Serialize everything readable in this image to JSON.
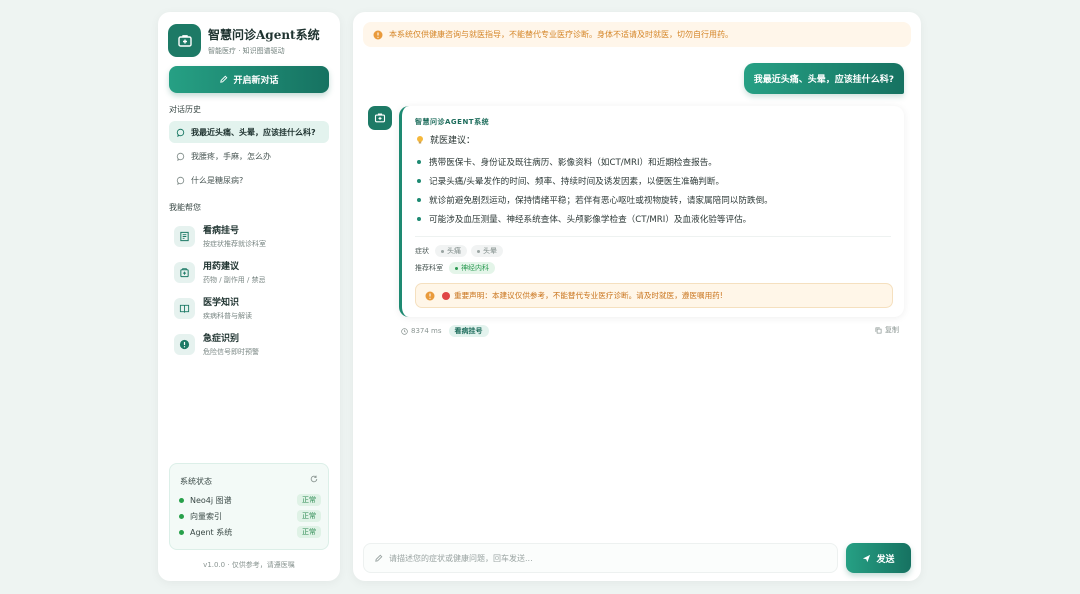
{
  "brand": {
    "title": "智慧问诊Agent系统",
    "subtitle": "智能医疗 · 知识图谱驱动",
    "icon": "medical-kit-icon"
  },
  "sidebar": {
    "new_chat_label": "开启新对话",
    "history_title": "对话历史",
    "history": [
      {
        "label": "我最近头痛、头晕，应该挂什么科?",
        "active": true
      },
      {
        "label": "我腰疼，手麻，怎么办",
        "active": false
      },
      {
        "label": "什么是糖尿病?",
        "active": false
      }
    ],
    "help_title": "我能帮您",
    "help_items": [
      {
        "title": "看病挂号",
        "desc": "按症状推荐就诊科室",
        "icon": "hospital-icon"
      },
      {
        "title": "用药建议",
        "desc": "药物 / 副作用 / 禁忌",
        "icon": "medicine-icon"
      },
      {
        "title": "医学知识",
        "desc": "疾病科普与解读",
        "icon": "book-icon"
      },
      {
        "title": "急症识别",
        "desc": "危险信号即时预警",
        "icon": "alert-icon"
      }
    ],
    "status": {
      "title": "系统状态",
      "rows": [
        {
          "name": "Neo4j 图谱",
          "state": "正常"
        },
        {
          "name": "向量索引",
          "state": "正常"
        },
        {
          "name": "Agent 系统",
          "state": "正常"
        }
      ]
    },
    "footer": "v1.0.0 · 仅供参考，请遵医嘱"
  },
  "main": {
    "notice": "本系统仅供健康咨询与就医指导，不能替代专业医疗诊断。身体不适请及时就医，切勿自行用药。",
    "user_message": "我最近头痛、头晕，应该挂什么科?",
    "bot": {
      "name": "智慧问诊AGENT系统",
      "advice_title": "就医建议：",
      "bullets": [
        "携带医保卡、身份证及既往病历、影像资料（如CT/MRI）和近期检查报告。",
        "记录头痛/头晕发作的时间、频率、持续时间及诱发因素，以便医生准确判断。",
        "就诊前避免剧烈运动，保持情绪平稳；若伴有恶心呕吐或视物旋转，请家属陪同以防跌倒。",
        "可能涉及血压测量、神经系统查体、头颅影像学检查（CT/MRI）及血液化验等评估。"
      ],
      "symptom_label": "症状",
      "symptoms": [
        "头痛",
        "头晕"
      ],
      "dept_label": "推荐科室",
      "departments": [
        "神经内科"
      ],
      "disclaimer": "重要声明：本建议仅供参考，不能替代专业医疗诊断。请及时就医，遵医嘱用药!"
    },
    "meta": {
      "time": "8374 ms",
      "tag": "看病挂号",
      "copy_label": "复制"
    },
    "input_placeholder": "请描述您的症状或健康问题，回车发送...",
    "send_label": "发送"
  },
  "colors": {
    "primary": "#1d7a66",
    "accent_gradient_start": "#26a084",
    "accent_gradient_end": "#167261",
    "warning": "#d58628",
    "ok": "#27a04a"
  }
}
